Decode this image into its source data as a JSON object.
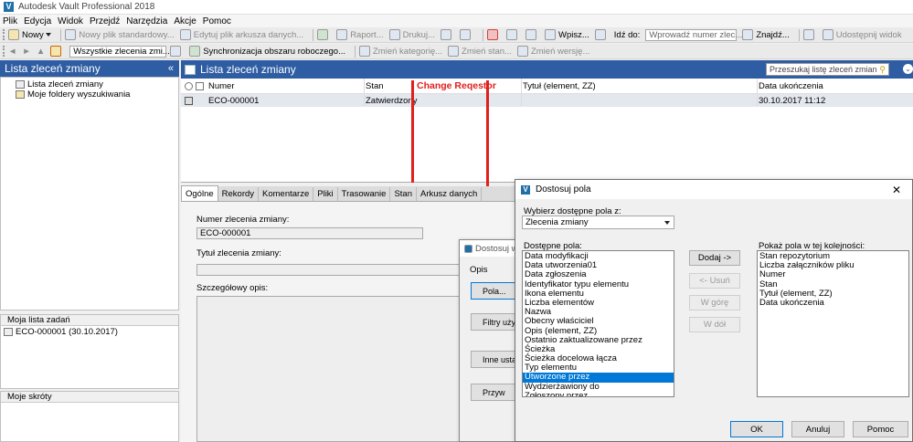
{
  "window": {
    "title": "Autodesk Vault Professional 2018",
    "logo": "V"
  },
  "menu": [
    "Plik",
    "Edycja",
    "Widok",
    "Przejdź",
    "Narzędzia",
    "Akcje",
    "Pomoc"
  ],
  "toolbar1": {
    "new": "Nowy",
    "new_std": "Nowy plik standardowy...",
    "edit_sheet": "Edytuj plik arkusza danych...",
    "report": "Raport...",
    "print": "Drukuj...",
    "write": "Wpisz...",
    "goto_label": "Idź do:",
    "goto_placeholder": "Wprowadź numer zlec...",
    "find": "Znajdź...",
    "share": "Udostępnij widok"
  },
  "toolbar2": {
    "view_select": "Wszystkie zlecenia zmi...",
    "sync": "Synchronizacja obszaru roboczego...",
    "change_cat": "Zmień kategorię...",
    "change_state": "Zmień stan...",
    "change_rev": "Zmień wersję..."
  },
  "left_panel": {
    "title": "Lista zleceń zmiany",
    "collapse": "«",
    "tree": [
      "Lista zleceń zmiany",
      "Moje foldery wyszukiwania"
    ],
    "tasks_title": "Moja lista zadań",
    "tasks": [
      "ECO-000001 (30.10.2017)"
    ],
    "shortcuts_title": "Moje skróty"
  },
  "main": {
    "title": "Lista zleceń zmiany",
    "search_placeholder": "Przeszukaj listę zleceń zmian",
    "columns": [
      "Numer",
      "Stan",
      "Change Reqestor",
      "Tytuł (element, ZZ)",
      "Data ukończenia"
    ],
    "rows": [
      {
        "numer": "ECO-000001",
        "stan": "Zatwierdzony",
        "requestor": "",
        "tytul": "",
        "data": "30.10.2017 11:12"
      }
    ]
  },
  "annotation": {
    "text": "Change Reqestor",
    "color": "#e0201d"
  },
  "tabs": [
    "Ogólne",
    "Rekordy",
    "Komentarze",
    "Pliki",
    "Trasowanie",
    "Stan",
    "Arkusz danych"
  ],
  "details": {
    "number_label": "Numer zlecenia zmiany:",
    "number_value": "ECO-000001",
    "title_label": "Tytuł zlecenia zmiany:",
    "title_value": "",
    "desc_label": "Szczegółowy opis:"
  },
  "back_dialog": {
    "title": "Dostosuj wi",
    "section": "Opis",
    "buttons": [
      "Pola...",
      "Filtry użytk",
      "Inne ustaw",
      "Przyw"
    ]
  },
  "dialog": {
    "title": "Dostosuj pola",
    "close": "✕",
    "source_label": "Wybierz dostępne pola z:",
    "source_value": "Zlecenia zmiany",
    "available_label": "Dostępne pola:",
    "available": [
      "Data modyfikacji",
      "Data utworzenia01",
      "Data zgłoszenia",
      "Identyfikator typu elementu",
      "Ikona elementu",
      "Liczba elementów",
      "Nazwa",
      "Obecny właściciel",
      "Opis (element, ZZ)",
      "Ostatnio zaktualizowane przez",
      "Ścieżka",
      "Ścieżka docelowa łącza",
      "Typ elementu",
      "Utworzone przez",
      "Wydzierżawiony do",
      "Zgłoszony przez"
    ],
    "selected_index": 13,
    "order_label": "Pokaż pola w tej kolejności:",
    "order": [
      "Stan repozytorium",
      "Liczba załączników pliku",
      "Numer",
      "Stan",
      "Tytuł (element, ZZ)",
      "Data ukończenia"
    ],
    "add": "Dodaj ->",
    "remove": "<- Usuń",
    "up": "W górę",
    "down": "W dół",
    "ok": "OK",
    "cancel": "Anuluj",
    "help": "Pomoc"
  }
}
